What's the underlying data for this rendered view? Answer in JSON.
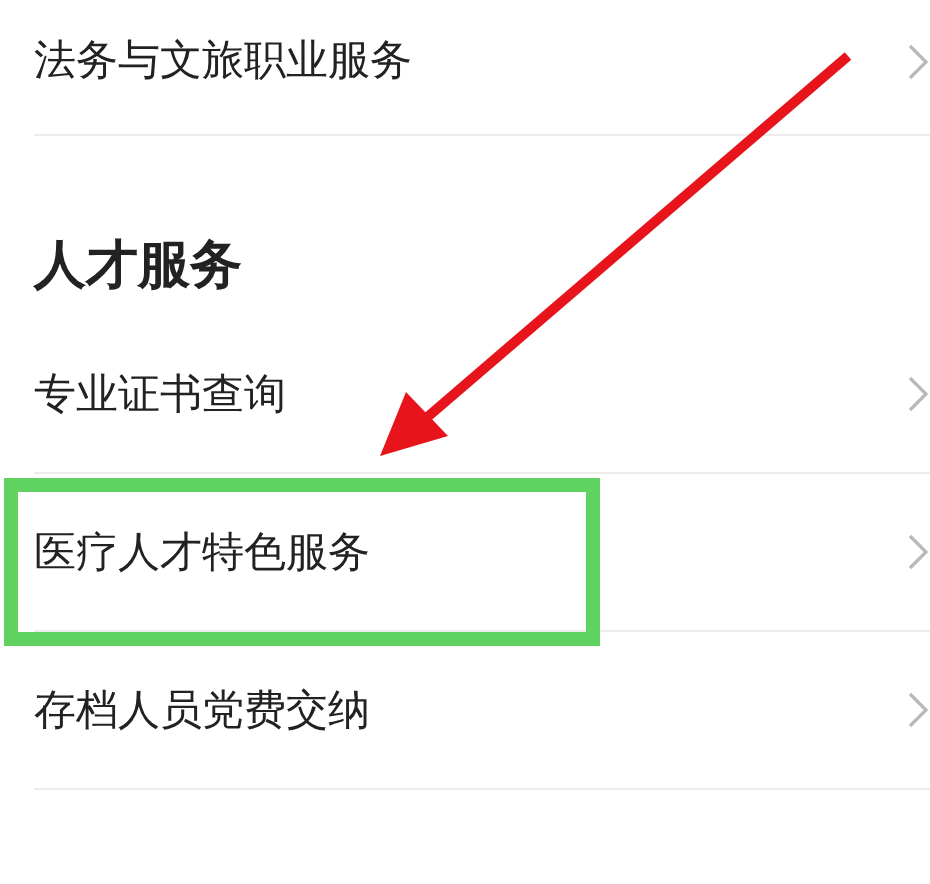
{
  "sections": [
    {
      "items": [
        {
          "label": "法务与文旅职业服务",
          "highlighted": false
        }
      ]
    },
    {
      "title": "人才服务",
      "items": [
        {
          "label": "专业证书查询",
          "highlighted": false
        },
        {
          "label": "医疗人才特色服务",
          "highlighted": true
        },
        {
          "label": "存档人员党费交纳",
          "highlighted": false
        }
      ]
    }
  ]
}
